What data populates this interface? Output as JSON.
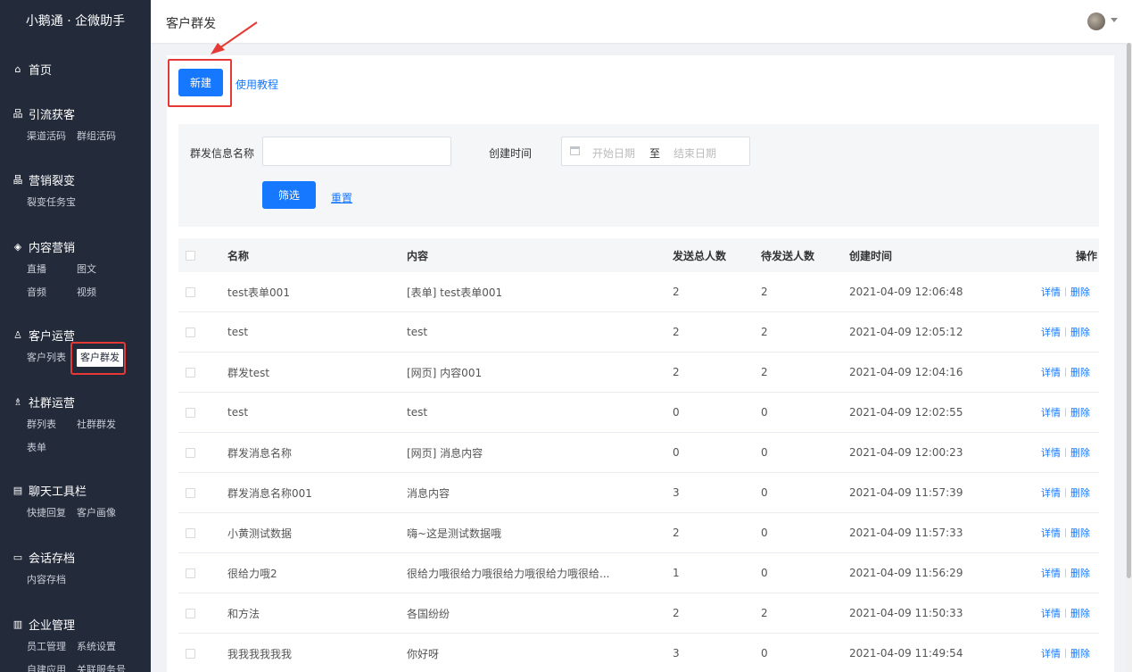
{
  "brand": "小鹅通 · 企微助手",
  "header": {
    "title": "客户群发"
  },
  "sidebar": {
    "groups": [
      {
        "title": "首页",
        "icon": "home-icon",
        "items": []
      },
      {
        "title": "引流获客",
        "icon": "network-icon",
        "items": [
          "渠道活码",
          "群组活码"
        ]
      },
      {
        "title": "营销裂变",
        "icon": "hierarchy-icon",
        "items": [
          "裂变任务宝"
        ]
      },
      {
        "title": "内容营销",
        "icon": "layers-icon",
        "items": [
          "直播",
          "图文",
          "音频",
          "视频"
        ]
      },
      {
        "title": "客户运营",
        "icon": "user-icon",
        "items": [
          "客户列表",
          "客户群发"
        ]
      },
      {
        "title": "社群运营",
        "icon": "group-icon",
        "items": [
          "群列表",
          "社群群发",
          "表单"
        ]
      },
      {
        "title": "聊天工具栏",
        "icon": "toolbar-icon",
        "items": [
          "快捷回复",
          "客户画像"
        ]
      },
      {
        "title": "会话存档",
        "icon": "archive-icon",
        "items": [
          "内容存档"
        ]
      },
      {
        "title": "企业管理",
        "icon": "building-icon",
        "items": [
          "员工管理",
          "系统设置",
          "自建应用",
          "关联服务号"
        ]
      }
    ]
  },
  "toolbar": {
    "new_label": "新建",
    "tutorial_label": "使用教程"
  },
  "filter": {
    "name_label": "群发信息名称",
    "name_value": "",
    "time_label": "创建时间",
    "start_placeholder": "开始日期",
    "range_sep": "至",
    "end_placeholder": "结束日期",
    "submit_label": "筛选",
    "reset_label": "重置"
  },
  "table": {
    "headers": {
      "name": "名称",
      "content": "内容",
      "total": "发送总人数",
      "pending": "待发送人数",
      "time": "创建时间",
      "ops": "操作"
    },
    "op_detail": "详情",
    "op_delete": "删除",
    "rows": [
      {
        "name": "test表单001",
        "content": "[表单] test表单001",
        "total": "2",
        "pending": "2",
        "time": "2021-04-09 12:06:48"
      },
      {
        "name": "test",
        "content": "test",
        "total": "2",
        "pending": "2",
        "time": "2021-04-09 12:05:12"
      },
      {
        "name": "群发test",
        "content": "[网页] 内容001",
        "total": "2",
        "pending": "2",
        "time": "2021-04-09 12:04:16"
      },
      {
        "name": "test",
        "content": "test",
        "total": "0",
        "pending": "0",
        "time": "2021-04-09 12:02:55"
      },
      {
        "name": "群发消息名称",
        "content": "[网页] 消息内容",
        "total": "0",
        "pending": "0",
        "time": "2021-04-09 12:00:23"
      },
      {
        "name": "群发消息名称001",
        "content": "消息内容",
        "total": "3",
        "pending": "0",
        "time": "2021-04-09 11:57:39"
      },
      {
        "name": "小黄测试数据",
        "content": "嗨~这是测试数据哦",
        "total": "2",
        "pending": "0",
        "time": "2021-04-09 11:57:33"
      },
      {
        "name": "很给力哦2",
        "content": "很给力哦很给力哦很给力哦很给力哦很给...",
        "total": "1",
        "pending": "0",
        "time": "2021-04-09 11:56:29"
      },
      {
        "name": "和方法",
        "content": "各国纷纷",
        "total": "2",
        "pending": "2",
        "time": "2021-04-09 11:50:33"
      },
      {
        "name": "我我我我我我",
        "content": "你好呀",
        "total": "3",
        "pending": "0",
        "time": "2021-04-09 11:49:54"
      }
    ]
  },
  "colors": {
    "sidebar_bg": "#232a3a",
    "primary": "#1677ff",
    "highlight": "#e53935"
  }
}
